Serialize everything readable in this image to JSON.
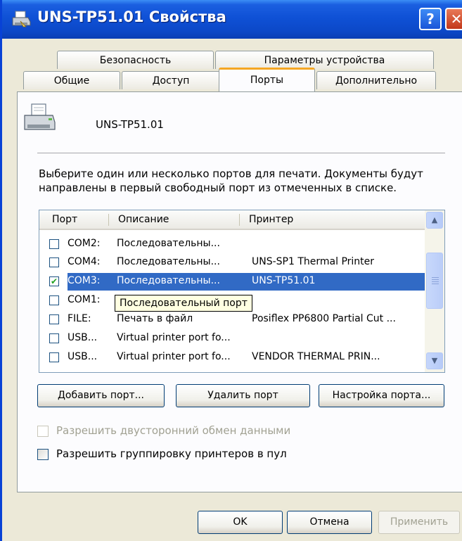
{
  "window": {
    "title": "UNS-TP51.01 Свойства",
    "help_glyph": "?",
    "close_glyph": "✕"
  },
  "tabs": {
    "row1": [
      "Безопасность",
      "Параметры устройства"
    ],
    "row2": [
      "Общие",
      "Доступ",
      "Порты",
      "Дополнительно"
    ],
    "active": "Порты"
  },
  "printer": {
    "name": "UNS-TP51.01",
    "icon": "printer-icon"
  },
  "description": "Выберите один или несколько портов для печати. Документы будут направлены в первый свободный порт из отмеченных в списке.",
  "port_list": {
    "columns": [
      "Порт",
      "Описание",
      "Принтер"
    ],
    "rows": [
      {
        "port": "COM2:",
        "desc": "Последовательны...",
        "printer": "",
        "checked": false,
        "selected": false
      },
      {
        "port": "COM4:",
        "desc": "Последовательны...",
        "printer": "UNS-SP1 Thermal Printer",
        "checked": false,
        "selected": false
      },
      {
        "port": "COM3:",
        "desc": "Последовательны...",
        "printer": "UNS-TP51.01",
        "checked": true,
        "selected": true
      },
      {
        "port": "COM1:",
        "desc": "",
        "printer": "",
        "checked": false,
        "selected": false
      },
      {
        "port": "FILE:",
        "desc": "Печать в файл",
        "printer": "Posiflex PP6800 Partial Cut ...",
        "checked": false,
        "selected": false
      },
      {
        "port": "USB...",
        "desc": "Virtual printer port fo...",
        "printer": "",
        "checked": false,
        "selected": false
      },
      {
        "port": "USB...",
        "desc": "Virtual printer port fo...",
        "printer": "VENDOR THERMAL PRIN...",
        "checked": false,
        "selected": false
      }
    ],
    "tooltip": "Последовательный порт",
    "scroll_up_glyph": "▲",
    "scroll_down_glyph": "▼",
    "check_glyph": "✔"
  },
  "port_buttons": {
    "add": "Добавить порт...",
    "delete": "Удалить порт",
    "configure": "Настройка порта..."
  },
  "options": {
    "bidirectional": {
      "label": "Разрешить двусторонний обмен данными",
      "checked": false,
      "enabled": false
    },
    "pooling": {
      "label": "Разрешить группировку принтеров в пул",
      "checked": false,
      "enabled": true
    }
  },
  "dialog_buttons": {
    "ok": "OK",
    "cancel": "Отмена",
    "apply": "Применить"
  },
  "colors": {
    "selection": "#316ac5",
    "titlebar": "#0f51d6",
    "tab_highlight": "#f5a623"
  }
}
